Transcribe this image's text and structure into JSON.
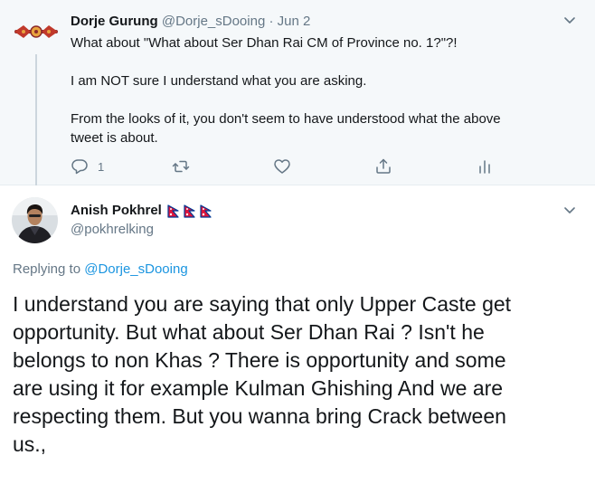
{
  "parent": {
    "author_name": "Dorje Gurung",
    "author_handle": "@Dorje_sDooing",
    "separator": "·",
    "date": "Jun 2",
    "lines": [
      "What about \"What about Ser Dhan Rai CM of Province no. 1?\"?!",
      "I am NOT sure I understand what you are asking.",
      "From the looks of it, you don't seem to have understood what the above",
      "tweet is about."
    ],
    "actions": {
      "reply_icon": "reply-icon",
      "reply_count": "1",
      "retweet_icon": "retweet-icon",
      "like_icon": "heart-icon",
      "share_icon": "share-icon",
      "analytics_icon": "analytics-icon"
    }
  },
  "reply": {
    "author_name": "Anish Pokhrel",
    "author_handle": "@pokhrelking",
    "flags": [
      "nepal-flag-icon",
      "nepal-flag-icon",
      "nepal-flag-icon"
    ],
    "replying_prefix": "Replying to",
    "replying_handle": "@Dorje_sDooing",
    "body_lines": [
      "I understand you are saying that only Upper Caste get",
      "opportunity. But what about Ser Dhan Rai ? Isn't he",
      "belongs to non Khas ? There is opportunity and some",
      "are using it for example Kulman Ghishing And we are",
      "respecting them. But you wanna bring Crack between",
      "us.,"
    ]
  },
  "colors": {
    "text": "#14171a",
    "secondary": "#657786",
    "link": "#1b95e0",
    "parent_bg": "#f5f8fa",
    "thread_line": "#ccd6dd",
    "flag_red": "#dc143c",
    "flag_blue": "#003893"
  }
}
